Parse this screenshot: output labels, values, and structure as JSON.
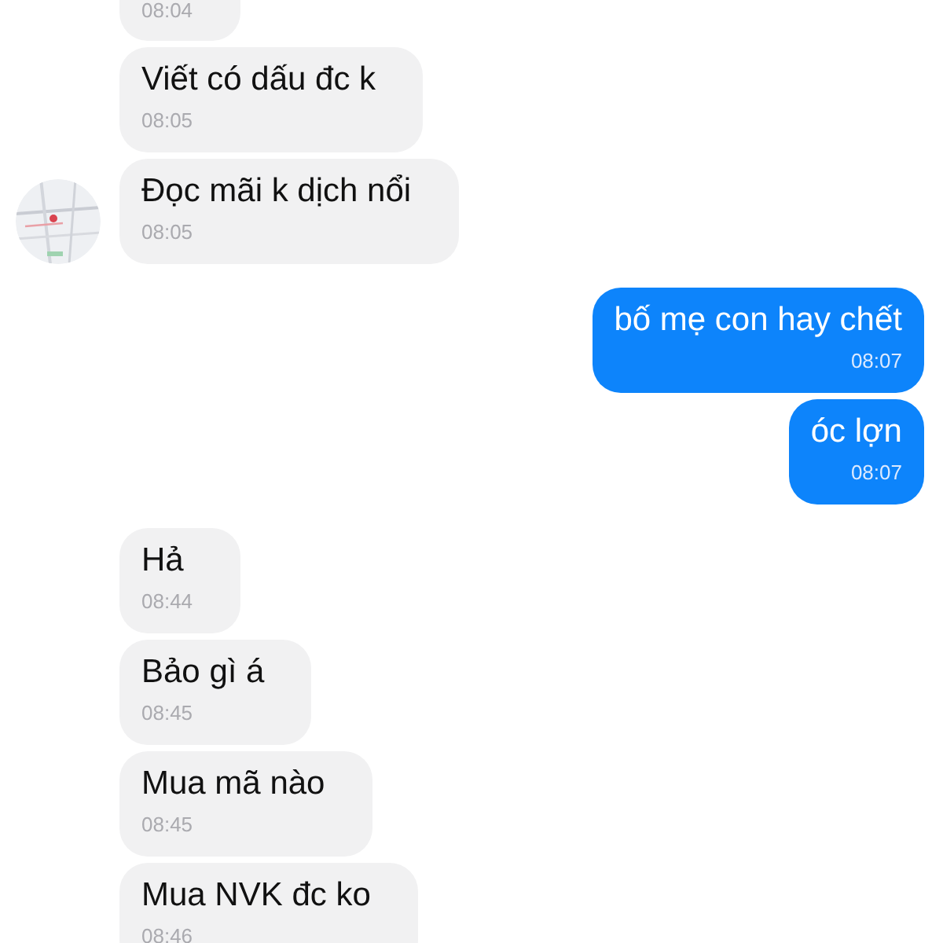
{
  "messages": [
    {
      "kind": "received",
      "time": "08:04",
      "avatar": false
    },
    {
      "kind": "received",
      "text": "Viết có dấu đc k",
      "time": "08:05",
      "avatar": false
    },
    {
      "kind": "received",
      "text": "Đọc mãi k dịch nổi",
      "time": "08:05",
      "avatar": true
    },
    {
      "kind": "sent",
      "text": "bố mẹ con hay chết",
      "time": "08:07"
    },
    {
      "kind": "sent",
      "text": "óc lợn",
      "time": "08:07"
    },
    {
      "kind": "received",
      "text": "Hả",
      "time": "08:44",
      "avatar": false
    },
    {
      "kind": "received",
      "text": "Bảo gì á",
      "time": "08:45",
      "avatar": false
    },
    {
      "kind": "received",
      "text": "Mua mã nào",
      "time": "08:45",
      "avatar": false
    },
    {
      "kind": "received",
      "text": "Mua NVK đc ko",
      "time": "08:46",
      "avatar": false
    }
  ]
}
